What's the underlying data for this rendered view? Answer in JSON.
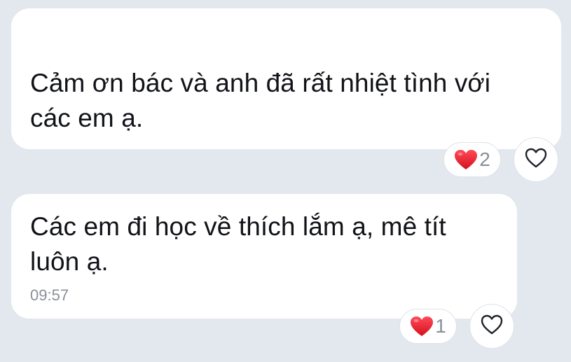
{
  "messages": [
    {
      "text_line_1": "Cảm ơn bác và anh đã rất nhiệt tình với",
      "text_line_2": "các em ạ.",
      "reaction": {
        "icon": "red-heart-icon",
        "count": "2"
      },
      "like_icon": "heart-outline-icon"
    },
    {
      "text_line_1": "Các em đi học về thích lắm ạ, mê tít",
      "text_line_2": "luôn ạ.",
      "time": "09:57",
      "reaction": {
        "icon": "red-heart-icon",
        "count": "1"
      },
      "like_icon": "heart-outline-icon"
    }
  ],
  "colors": {
    "background": "#e3e8ef",
    "bubble": "#ffffff",
    "text": "#111318",
    "muted": "#8a9099",
    "heart": "#e5202e"
  }
}
